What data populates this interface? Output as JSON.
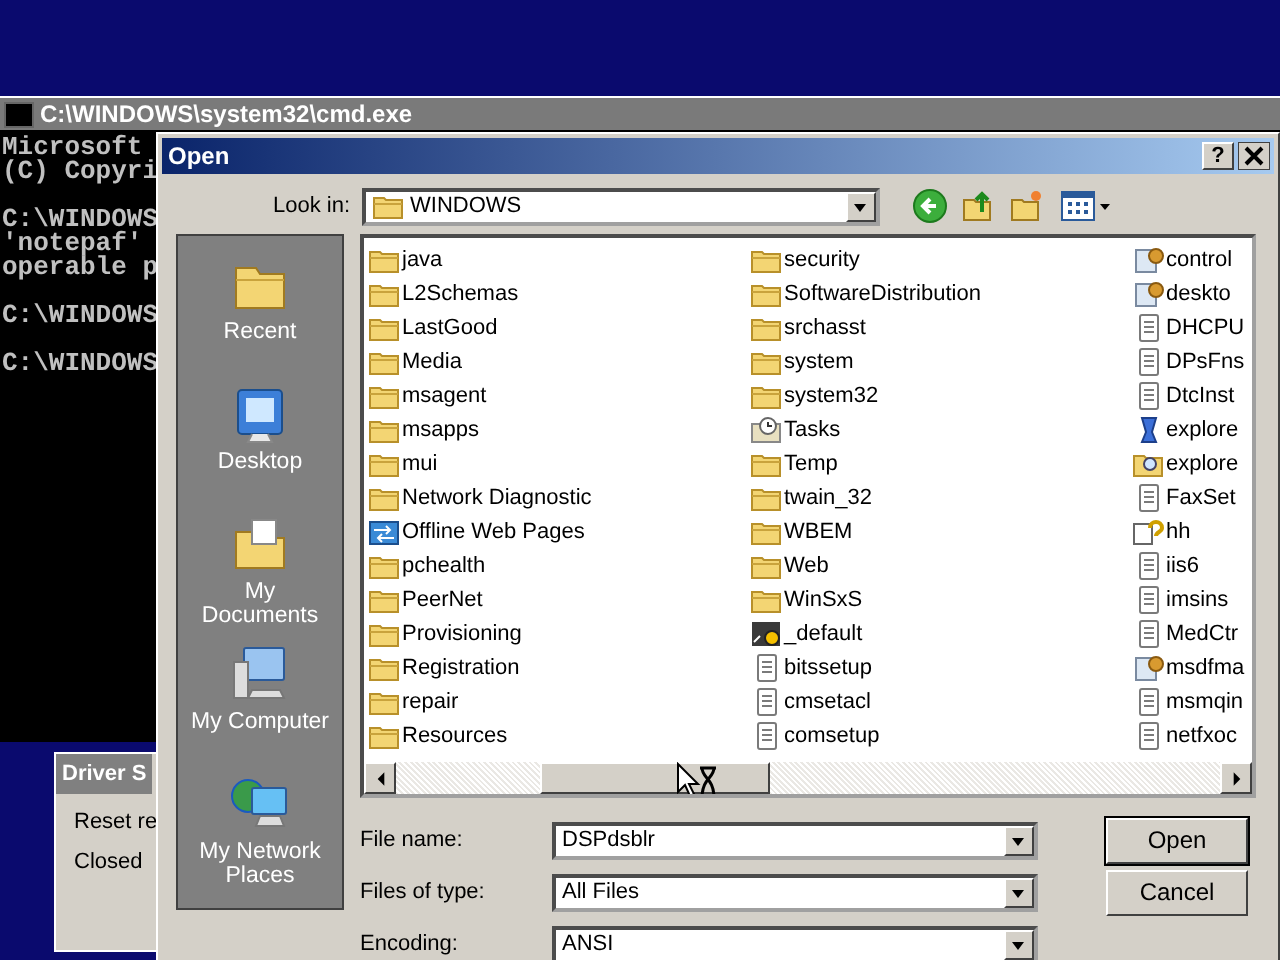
{
  "cmd_window": {
    "title": "C:\\WINDOWS\\system32\\cmd.exe",
    "blocks": [
      [
        "Microsoft",
        "(C) Copyri"
      ],
      [
        "C:\\WINDOWS",
        "'notepaf'",
        "operable p"
      ],
      [
        "C:\\WINDOWS"
      ],
      [
        "C:\\WINDOWS"
      ]
    ]
  },
  "driver_window": {
    "title": "Driver S",
    "lines": [
      "Reset re",
      "Closed"
    ]
  },
  "dialog": {
    "title": "Open",
    "help_button": "?",
    "look_in": {
      "label": "Look in:",
      "value": "WINDOWS"
    },
    "places": [
      {
        "label": "Recent",
        "kind": "recent"
      },
      {
        "label": "Desktop",
        "kind": "desktop"
      },
      {
        "label": "My Documents",
        "kind": "documents"
      },
      {
        "label": "My Computer",
        "kind": "computer"
      },
      {
        "label": "My Network Places",
        "kind": "network"
      }
    ],
    "files": [
      {
        "name": "java",
        "kind": "folder"
      },
      {
        "name": "L2Schemas",
        "kind": "folder"
      },
      {
        "name": "LastGood",
        "kind": "folder"
      },
      {
        "name": "Media",
        "kind": "folder"
      },
      {
        "name": "msagent",
        "kind": "folder"
      },
      {
        "name": "msapps",
        "kind": "folder"
      },
      {
        "name": "mui",
        "kind": "folder"
      },
      {
        "name": "Network Diagnostic",
        "kind": "folder"
      },
      {
        "name": "Offline Web Pages",
        "kind": "offline"
      },
      {
        "name": "pchealth",
        "kind": "folder"
      },
      {
        "name": "PeerNet",
        "kind": "folder"
      },
      {
        "name": "Provisioning",
        "kind": "folder"
      },
      {
        "name": "Registration",
        "kind": "folder"
      },
      {
        "name": "repair",
        "kind": "folder"
      },
      {
        "name": "Resources",
        "kind": "folder"
      },
      {
        "name": "security",
        "kind": "folder"
      },
      {
        "name": "SoftwareDistribution",
        "kind": "folder"
      },
      {
        "name": "srchasst",
        "kind": "folder"
      },
      {
        "name": "system",
        "kind": "folder"
      },
      {
        "name": "system32",
        "kind": "folder"
      },
      {
        "name": "Tasks",
        "kind": "tasks"
      },
      {
        "name": "Temp",
        "kind": "folder"
      },
      {
        "name": "twain_32",
        "kind": "folder"
      },
      {
        "name": "WBEM",
        "kind": "folder"
      },
      {
        "name": "Web",
        "kind": "folder"
      },
      {
        "name": "WinSxS",
        "kind": "folder"
      },
      {
        "name": "_default",
        "kind": "media"
      },
      {
        "name": "bitssetup",
        "kind": "text"
      },
      {
        "name": "cmsetacl",
        "kind": "text"
      },
      {
        "name": "comsetup",
        "kind": "text"
      },
      {
        "name": "control",
        "kind": "settings"
      },
      {
        "name": "deskto",
        "kind": "settings"
      },
      {
        "name": "DHCPU",
        "kind": "text"
      },
      {
        "name": "DPsFns",
        "kind": "text"
      },
      {
        "name": "DtcInst",
        "kind": "text"
      },
      {
        "name": "explore",
        "kind": "app"
      },
      {
        "name": "explore",
        "kind": "search"
      },
      {
        "name": "FaxSet",
        "kind": "text"
      },
      {
        "name": "hh",
        "kind": "help"
      },
      {
        "name": "iis6",
        "kind": "text"
      },
      {
        "name": "imsins",
        "kind": "text"
      },
      {
        "name": "MedCtr",
        "kind": "text"
      },
      {
        "name": "msdfma",
        "kind": "settings"
      },
      {
        "name": "msmqin",
        "kind": "text"
      },
      {
        "name": "netfxoc",
        "kind": "text"
      }
    ],
    "file_name": {
      "label": "File name:",
      "value": "DSPdsblr"
    },
    "file_type": {
      "label": "Files of type:",
      "value": "All Files"
    },
    "encoding": {
      "label": "Encoding:",
      "value": "ANSI"
    },
    "buttons": [
      "Open",
      "Cancel"
    ]
  }
}
